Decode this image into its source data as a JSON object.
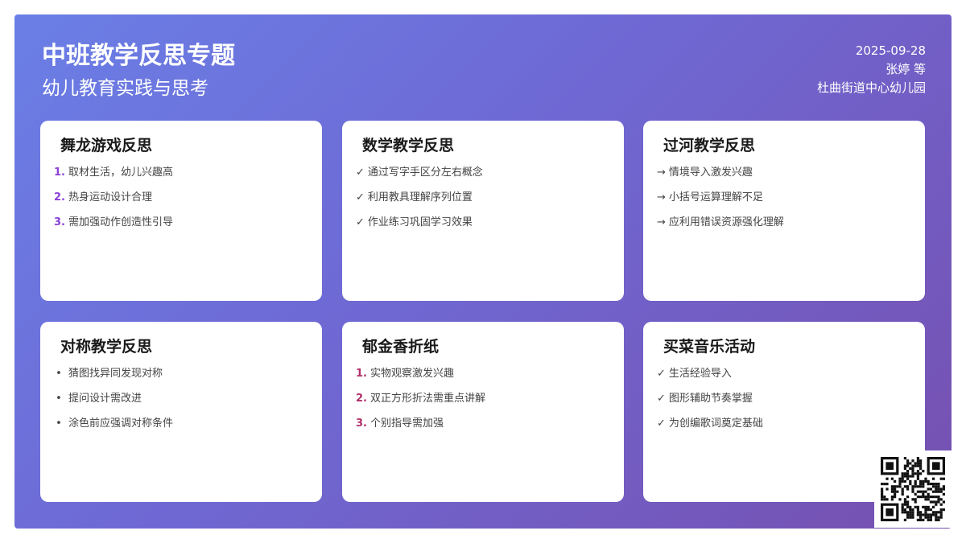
{
  "header": {
    "title": "中班教学反思专题",
    "subtitle": "幼儿教育实践与思考",
    "date": "2025-09-28",
    "author": "张婷 等",
    "org": "杜曲街道中心幼儿园"
  },
  "cards": [
    {
      "title": "舞龙游戏反思",
      "marker_style": "number",
      "items": [
        {
          "marker": "1.",
          "text": "取材生活，幼儿兴趣高"
        },
        {
          "marker": "2.",
          "text": "热身运动设计合理"
        },
        {
          "marker": "3.",
          "text": "需加强动作创造性引导"
        }
      ]
    },
    {
      "title": "数学教学反思",
      "marker_style": "check",
      "items": [
        {
          "marker": "✓",
          "text": "通过写字手区分左右概念"
        },
        {
          "marker": "✓",
          "text": "利用教具理解序列位置"
        },
        {
          "marker": "✓",
          "text": "作业练习巩固学习效果"
        }
      ]
    },
    {
      "title": "过河教学反思",
      "marker_style": "arrow",
      "items": [
        {
          "marker": "→",
          "text": "情境导入激发兴趣"
        },
        {
          "marker": "→",
          "text": "小括号运算理解不足"
        },
        {
          "marker": "→",
          "text": "应利用错误资源强化理解"
        }
      ]
    },
    {
      "title": "对称教学反思",
      "marker_style": "bullet",
      "items": [
        {
          "marker": "•",
          "text": "猜图找异同发现对称"
        },
        {
          "marker": "•",
          "text": "提问设计需改进"
        },
        {
          "marker": "•",
          "text": "涂色前应强调对称条件"
        }
      ]
    },
    {
      "title": "郁金香折纸",
      "marker_style": "number",
      "items": [
        {
          "marker": "1.",
          "text": "实物观察激发兴趣"
        },
        {
          "marker": "2.",
          "text": "双正方形折法需重点讲解"
        },
        {
          "marker": "3.",
          "text": "个别指导需加强"
        }
      ]
    },
    {
      "title": "买菜音乐活动",
      "marker_style": "check",
      "items": [
        {
          "marker": "✓",
          "text": "生活经验导入"
        },
        {
          "marker": "✓",
          "text": "图形辅助节奏掌握"
        },
        {
          "marker": "✓",
          "text": "为创编歌词奠定基础"
        }
      ]
    }
  ],
  "colors": {
    "gradient_start": "#6a7fe6",
    "gradient_end": "#7650b0",
    "number_purple": "#8a3fd6",
    "number_pink": "#b0306a"
  },
  "qr_icon": "qr-code-icon"
}
